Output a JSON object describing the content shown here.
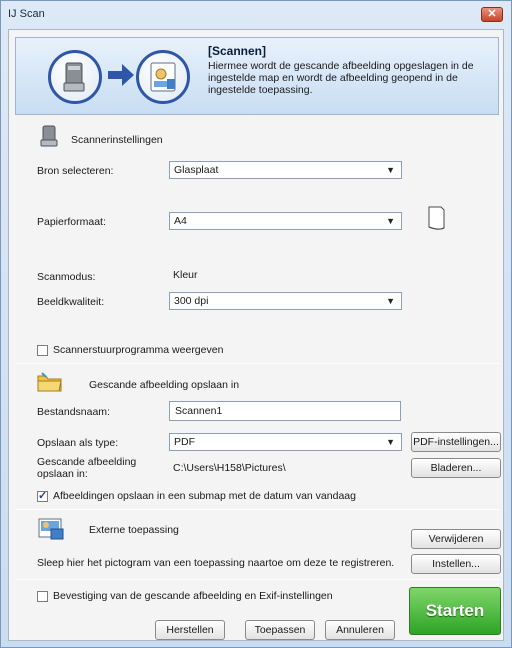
{
  "window": {
    "title": "IJ Scan",
    "close_label": "✕"
  },
  "banner": {
    "heading": "[Scannen]",
    "description": "Hiermee wordt de gescande afbeelding opgeslagen in de ingestelde map en wordt de afbeelding geopend in de ingestelde toepassing."
  },
  "scanner_settings": {
    "section_title": "Scannerinstellingen",
    "source_label": "Bron selecteren:",
    "source_value": "Glasplaat",
    "paper_label": "Papierformaat:",
    "paper_value": "A4",
    "mode_label": "Scanmodus:",
    "mode_value": "Kleur",
    "quality_label": "Beeldkwaliteit:",
    "quality_value": "300 dpi",
    "driver_checkbox_label": "Scannerstuurprogramma weergeven",
    "driver_checked": false
  },
  "save_settings": {
    "section_title": "Gescande afbeelding opslaan in",
    "filename_label": "Bestandsnaam:",
    "filename_value": "Scannen1",
    "filetype_label": "Opslaan als type:",
    "filetype_value": "PDF",
    "pdf_settings_button": "PDF-instellingen...",
    "location_label": "Gescande afbeelding opslaan in:",
    "location_value": "C:\\Users\\H158\\Pictures\\",
    "browse_button": "Bladeren...",
    "subfolder_checkbox_label": "Afbeeldingen opslaan in een submap met de datum van vandaag",
    "subfolder_checked": true
  },
  "external_app": {
    "section_title": "Externe toepassing",
    "remove_button": "Verwijderen",
    "hint": "Sleep hier het pictogram van een toepassing naartoe om deze te registreren.",
    "settings_button": "Instellen..."
  },
  "footer": {
    "confirm_checkbox_label": "Bevestiging van de gescande afbeelding en Exif-instellingen",
    "confirm_checked": false,
    "reset_button": "Herstellen",
    "apply_button": "Toepassen",
    "cancel_button": "Annuleren",
    "start_button": "Starten"
  },
  "icons": {
    "scanner": "scanner-icon",
    "arrow": "arrow-right-icon",
    "application": "application-icon",
    "paper": "paper-orientation-icon",
    "folder": "folder-icon",
    "external_app": "external-app-icon"
  },
  "colors": {
    "accent": "#2f56a8",
    "start": "#2ea426",
    "close": "#c6452c"
  }
}
